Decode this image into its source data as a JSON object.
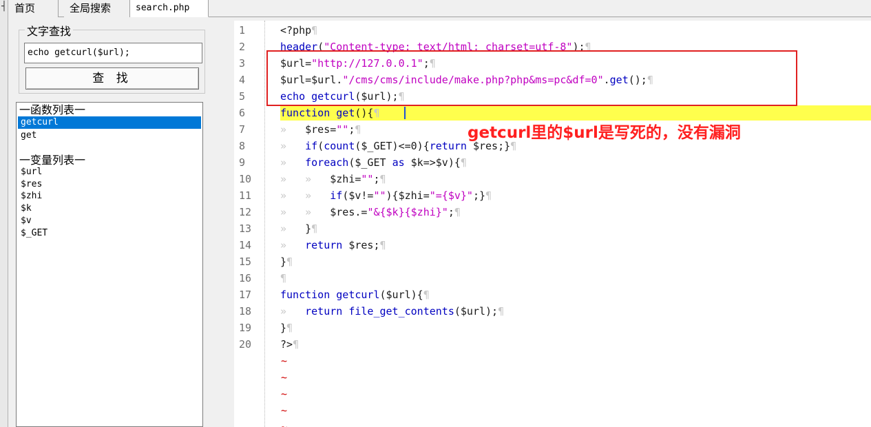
{
  "tabs": [
    "首页",
    "全局搜索",
    "search.php"
  ],
  "search": {
    "group_title": "文字查找",
    "input_value": "echo getcurl($url);",
    "button_label": "查 找"
  },
  "lists": {
    "functions_header": "一函数列表一",
    "functions": [
      "getcurl",
      "get"
    ],
    "selected_function": "getcurl",
    "variables_header": "一变量列表一",
    "variables": [
      "$url",
      "$res",
      "$zhi",
      "$k",
      "$v",
      "$_GET"
    ]
  },
  "editor": {
    "line_numbers": [
      "1",
      "2",
      "3",
      "4",
      "5",
      "6",
      "7",
      "8",
      "9",
      "10",
      "11",
      "12",
      "13",
      "14",
      "15",
      "16",
      "17",
      "18",
      "19",
      "20"
    ],
    "lines": [
      "<?php",
      "header(\"Content-type: text/html; charset=utf-8\");",
      "$url=\"http://127.0.0.1\";",
      "$url=$url.\"/cms/cms/include/make.php?php&ms=pc&df=0\".get();",
      "echo getcurl($url);",
      "function get(){",
      "    $res=\"\";",
      "    if(count($_GET)<=0){return $res;}",
      "    foreach($_GET as $k=>$v){",
      "        $zhi=\"\";",
      "        if($v!=\"\"){$zhi=\"={$v}\";}",
      "        $res.=\"&{$k}{$zhi}\";",
      "    }",
      "    return $res;",
      "}",
      "",
      "function getcurl($url){",
      "    return file_get_contents($url);",
      "}",
      "?>"
    ],
    "tilde": "~",
    "highlighted_line": 6
  },
  "annotation": {
    "text": "getcurl里的$url是写死的，没有漏洞",
    "color": "#ff2020"
  },
  "colors": {
    "keyword": "#0000c0",
    "string": "#c000c0",
    "highlight": "#ffff4d",
    "selection": "#0078d7"
  }
}
